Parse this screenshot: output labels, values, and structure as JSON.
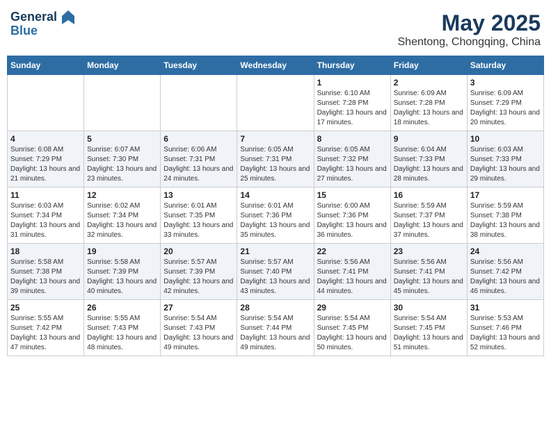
{
  "header": {
    "logo_line1": "General",
    "logo_line2": "Blue",
    "month_year": "May 2025",
    "location": "Shentong, Chongqing, China"
  },
  "days_of_week": [
    "Sunday",
    "Monday",
    "Tuesday",
    "Wednesday",
    "Thursday",
    "Friday",
    "Saturday"
  ],
  "weeks": [
    [
      {
        "day": "",
        "info": ""
      },
      {
        "day": "",
        "info": ""
      },
      {
        "day": "",
        "info": ""
      },
      {
        "day": "",
        "info": ""
      },
      {
        "day": "1",
        "info": "Sunrise: 6:10 AM\nSunset: 7:28 PM\nDaylight: 13 hours and 17 minutes."
      },
      {
        "day": "2",
        "info": "Sunrise: 6:09 AM\nSunset: 7:28 PM\nDaylight: 13 hours and 18 minutes."
      },
      {
        "day": "3",
        "info": "Sunrise: 6:09 AM\nSunset: 7:29 PM\nDaylight: 13 hours and 20 minutes."
      }
    ],
    [
      {
        "day": "4",
        "info": "Sunrise: 6:08 AM\nSunset: 7:29 PM\nDaylight: 13 hours and 21 minutes."
      },
      {
        "day": "5",
        "info": "Sunrise: 6:07 AM\nSunset: 7:30 PM\nDaylight: 13 hours and 23 minutes."
      },
      {
        "day": "6",
        "info": "Sunrise: 6:06 AM\nSunset: 7:31 PM\nDaylight: 13 hours and 24 minutes."
      },
      {
        "day": "7",
        "info": "Sunrise: 6:05 AM\nSunset: 7:31 PM\nDaylight: 13 hours and 25 minutes."
      },
      {
        "day": "8",
        "info": "Sunrise: 6:05 AM\nSunset: 7:32 PM\nDaylight: 13 hours and 27 minutes."
      },
      {
        "day": "9",
        "info": "Sunrise: 6:04 AM\nSunset: 7:33 PM\nDaylight: 13 hours and 28 minutes."
      },
      {
        "day": "10",
        "info": "Sunrise: 6:03 AM\nSunset: 7:33 PM\nDaylight: 13 hours and 29 minutes."
      }
    ],
    [
      {
        "day": "11",
        "info": "Sunrise: 6:03 AM\nSunset: 7:34 PM\nDaylight: 13 hours and 31 minutes."
      },
      {
        "day": "12",
        "info": "Sunrise: 6:02 AM\nSunset: 7:34 PM\nDaylight: 13 hours and 32 minutes."
      },
      {
        "day": "13",
        "info": "Sunrise: 6:01 AM\nSunset: 7:35 PM\nDaylight: 13 hours and 33 minutes."
      },
      {
        "day": "14",
        "info": "Sunrise: 6:01 AM\nSunset: 7:36 PM\nDaylight: 13 hours and 35 minutes."
      },
      {
        "day": "15",
        "info": "Sunrise: 6:00 AM\nSunset: 7:36 PM\nDaylight: 13 hours and 36 minutes."
      },
      {
        "day": "16",
        "info": "Sunrise: 5:59 AM\nSunset: 7:37 PM\nDaylight: 13 hours and 37 minutes."
      },
      {
        "day": "17",
        "info": "Sunrise: 5:59 AM\nSunset: 7:38 PM\nDaylight: 13 hours and 38 minutes."
      }
    ],
    [
      {
        "day": "18",
        "info": "Sunrise: 5:58 AM\nSunset: 7:38 PM\nDaylight: 13 hours and 39 minutes."
      },
      {
        "day": "19",
        "info": "Sunrise: 5:58 AM\nSunset: 7:39 PM\nDaylight: 13 hours and 40 minutes."
      },
      {
        "day": "20",
        "info": "Sunrise: 5:57 AM\nSunset: 7:39 PM\nDaylight: 13 hours and 42 minutes."
      },
      {
        "day": "21",
        "info": "Sunrise: 5:57 AM\nSunset: 7:40 PM\nDaylight: 13 hours and 43 minutes."
      },
      {
        "day": "22",
        "info": "Sunrise: 5:56 AM\nSunset: 7:41 PM\nDaylight: 13 hours and 44 minutes."
      },
      {
        "day": "23",
        "info": "Sunrise: 5:56 AM\nSunset: 7:41 PM\nDaylight: 13 hours and 45 minutes."
      },
      {
        "day": "24",
        "info": "Sunrise: 5:56 AM\nSunset: 7:42 PM\nDaylight: 13 hours and 46 minutes."
      }
    ],
    [
      {
        "day": "25",
        "info": "Sunrise: 5:55 AM\nSunset: 7:42 PM\nDaylight: 13 hours and 47 minutes."
      },
      {
        "day": "26",
        "info": "Sunrise: 5:55 AM\nSunset: 7:43 PM\nDaylight: 13 hours and 48 minutes."
      },
      {
        "day": "27",
        "info": "Sunrise: 5:54 AM\nSunset: 7:43 PM\nDaylight: 13 hours and 49 minutes."
      },
      {
        "day": "28",
        "info": "Sunrise: 5:54 AM\nSunset: 7:44 PM\nDaylight: 13 hours and 49 minutes."
      },
      {
        "day": "29",
        "info": "Sunrise: 5:54 AM\nSunset: 7:45 PM\nDaylight: 13 hours and 50 minutes."
      },
      {
        "day": "30",
        "info": "Sunrise: 5:54 AM\nSunset: 7:45 PM\nDaylight: 13 hours and 51 minutes."
      },
      {
        "day": "31",
        "info": "Sunrise: 5:53 AM\nSunset: 7:46 PM\nDaylight: 13 hours and 52 minutes."
      }
    ]
  ]
}
